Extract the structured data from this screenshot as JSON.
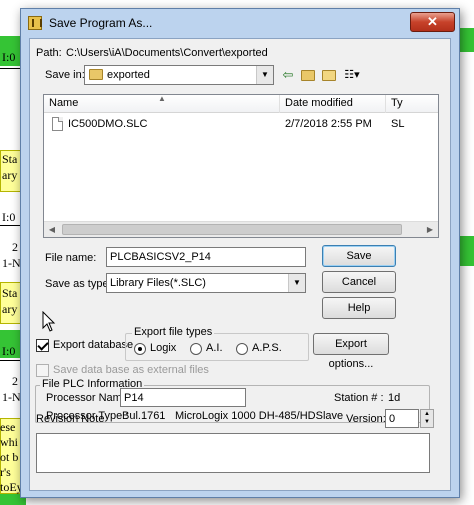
{
  "background_app": {
    "fragments": [
      {
        "text": "I:0"
      },
      {
        "text": "Sta"
      },
      {
        "text": "ary"
      },
      {
        "text": "I:0"
      },
      {
        "text": "2"
      },
      {
        "text": "1-N"
      },
      {
        "text": "Sta"
      },
      {
        "text": "ary"
      },
      {
        "text": "I:0"
      },
      {
        "text": "2"
      },
      {
        "text": "1-N"
      },
      {
        "text": "ese"
      },
      {
        "text": "whi"
      },
      {
        "text": "ot b"
      },
      {
        "text": "r's"
      },
      {
        "text": "toEy"
      }
    ],
    "colors": {
      "highlight_green": "#35c435",
      "note_yellow": "#ffff99"
    }
  },
  "dialog": {
    "title": "Save Program As...",
    "close_label": "✕",
    "path_label": "Path:",
    "path_value": "C:\\Users\\iA\\Documents\\Convert\\exported",
    "save_in_label": "Save in:",
    "save_in_value": "exported",
    "toolbar_icons": [
      "back-arrow-icon",
      "up-folder-icon",
      "new-folder-icon",
      "view-menu-icon"
    ],
    "file_list": {
      "columns": [
        "Name",
        "Date modified",
        "Ty"
      ],
      "rows": [
        {
          "name": "IC500DMO.SLC",
          "date": "2/7/2018 2:55 PM",
          "type": "SL"
        }
      ]
    },
    "file_name_label": "File name:",
    "file_name_value": "PLCBASICSV2_P14",
    "save_as_type_label": "Save as type:",
    "save_as_type_value": "Library Files(*.SLC)",
    "buttons": {
      "save": "Save",
      "cancel": "Cancel",
      "help": "Help",
      "export_options": "Export options..."
    },
    "export_database_label": "Export database",
    "export_database_checked": true,
    "export_file_types": {
      "label": "Export file types",
      "options": [
        "Logix",
        "A.I.",
        "A.P.S."
      ],
      "selected": "Logix"
    },
    "external_files_label": "Save data base as external files",
    "plc_info": {
      "group_label": "File PLC Information",
      "processor_name_label": "Processor Name :",
      "processor_name_value": "P14",
      "station_label": "Station # :",
      "station_value": "1d",
      "processor_type_label": "Processor Type :",
      "processor_type_model": "Bul.1761",
      "processor_type_desc": "MicroLogix 1000 DH-485/HDSlave"
    },
    "revision_note_label": "Revision Note",
    "version_label": "Version:",
    "version_value": "0",
    "revision_note_value": ""
  }
}
